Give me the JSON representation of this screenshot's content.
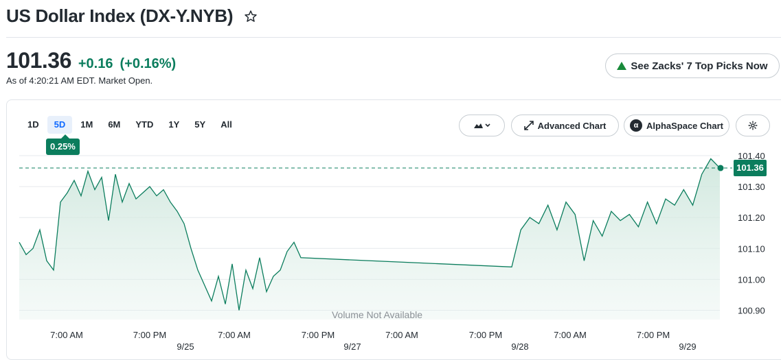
{
  "header": {
    "title": "US Dollar Index (DX-Y.NYB)",
    "price": "101.36",
    "change": "+0.16",
    "change_pct": "(+0.16%)",
    "as_of": "As of 4:20:21 AM EDT. Market Open."
  },
  "promo": {
    "label": "See Zacks' 7 Top Picks Now",
    "icon": "green-triangle-icon"
  },
  "range_tabs": [
    "1D",
    "5D",
    "1M",
    "6M",
    "YTD",
    "1Y",
    "5Y",
    "All"
  ],
  "active_range": "5D",
  "tooltip": "0.25%",
  "toolbar": {
    "chart_type_icon": "mountain-chart-icon",
    "advanced_chart": "Advanced Chart",
    "alphaspace_chart": "AlphaSpace Chart",
    "settings_icon": "gear-icon"
  },
  "current_price_tag": "101.36",
  "volume_note": "Volume Not Available",
  "colors": {
    "accent_green": "#0b7d5d",
    "fill_green": "#e3f1ec",
    "active_tab": "#0f69ff"
  },
  "chart_data": {
    "type": "area",
    "ylim": [
      100.87,
      101.42
    ],
    "yticks": [
      "101.40",
      "101.30",
      "101.20",
      "101.10",
      "101.00",
      "100.90"
    ],
    "reference_line": 101.36,
    "x_tick_labels": [
      "7:00 AM",
      "7:00 PM",
      "7:00 AM",
      "7:00 PM",
      "7:00 AM",
      "7:00 PM",
      "7:00 AM",
      "7:00 PM"
    ],
    "date_labels": [
      "9/25",
      "9/27",
      "9/28",
      "9/29"
    ],
    "series": [
      {
        "values": [
          101.12,
          101.08,
          101.1,
          101.16,
          101.06,
          101.03,
          101.25,
          101.28,
          101.32,
          101.27,
          101.35,
          101.29,
          101.33,
          101.19,
          101.34,
          101.25,
          101.31,
          101.26,
          101.28,
          101.3,
          101.27,
          101.29,
          101.25,
          101.22,
          101.18,
          101.1,
          101.03,
          100.98,
          100.93,
          101.01,
          100.92,
          101.05,
          100.9,
          101.03,
          100.97,
          101.07,
          100.96,
          101.01,
          101.03,
          101.09,
          101.12,
          101.07,
          101.04,
          101.16,
          101.2,
          101.18,
          101.24,
          101.16,
          101.25,
          101.21,
          101.06,
          101.19,
          101.14,
          101.22,
          101.19,
          101.21,
          101.17,
          101.25,
          101.18,
          101.26,
          101.24,
          101.29,
          101.24,
          101.34,
          101.39,
          101.36
        ]
      }
    ]
  }
}
